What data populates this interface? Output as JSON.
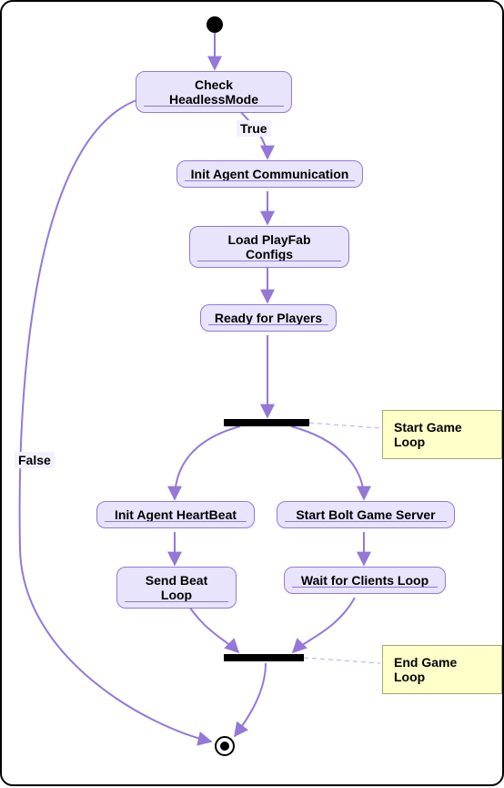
{
  "chart_data": {
    "type": "activity-diagram",
    "nodes": [
      {
        "id": "start",
        "name": "initial",
        "kind": "initial"
      },
      {
        "id": "n1",
        "name": "Check HeadlessMode",
        "kind": "activity"
      },
      {
        "id": "n2",
        "name": "Init Agent Communication",
        "kind": "activity"
      },
      {
        "id": "n3",
        "name": "Load PlayFab Configs",
        "kind": "activity"
      },
      {
        "id": "n4",
        "name": "Ready for Players",
        "kind": "activity"
      },
      {
        "id": "fork",
        "name": "fork-bar",
        "kind": "fork"
      },
      {
        "id": "n5",
        "name": "Init Agent HeartBeat",
        "kind": "activity"
      },
      {
        "id": "n6",
        "name": "Send Beat Loop",
        "kind": "activity"
      },
      {
        "id": "n7",
        "name": "Start Bolt Game Server",
        "kind": "activity"
      },
      {
        "id": "n8",
        "name": "Wait for Clients Loop",
        "kind": "activity"
      },
      {
        "id": "join",
        "name": "join-bar",
        "kind": "join"
      },
      {
        "id": "end",
        "name": "final",
        "kind": "final"
      }
    ],
    "edges": [
      {
        "from": "start",
        "to": "n1",
        "label": ""
      },
      {
        "from": "n1",
        "to": "n2",
        "label": "True"
      },
      {
        "from": "n1",
        "to": "end",
        "label": "False"
      },
      {
        "from": "n2",
        "to": "n3",
        "label": ""
      },
      {
        "from": "n3",
        "to": "n4",
        "label": ""
      },
      {
        "from": "n4",
        "to": "fork",
        "label": ""
      },
      {
        "from": "fork",
        "to": "n5",
        "label": ""
      },
      {
        "from": "fork",
        "to": "n7",
        "label": ""
      },
      {
        "from": "n5",
        "to": "n6",
        "label": ""
      },
      {
        "from": "n7",
        "to": "n8",
        "label": ""
      },
      {
        "from": "n6",
        "to": "join",
        "label": ""
      },
      {
        "from": "n8",
        "to": "join",
        "label": ""
      },
      {
        "from": "join",
        "to": "end",
        "label": ""
      }
    ],
    "notes": [
      {
        "attached_to": "fork",
        "text": "Start Game Loop"
      },
      {
        "attached_to": "join",
        "text": "End Game Loop"
      }
    ],
    "edge_labels": {
      "true": "True",
      "false": "False"
    }
  }
}
